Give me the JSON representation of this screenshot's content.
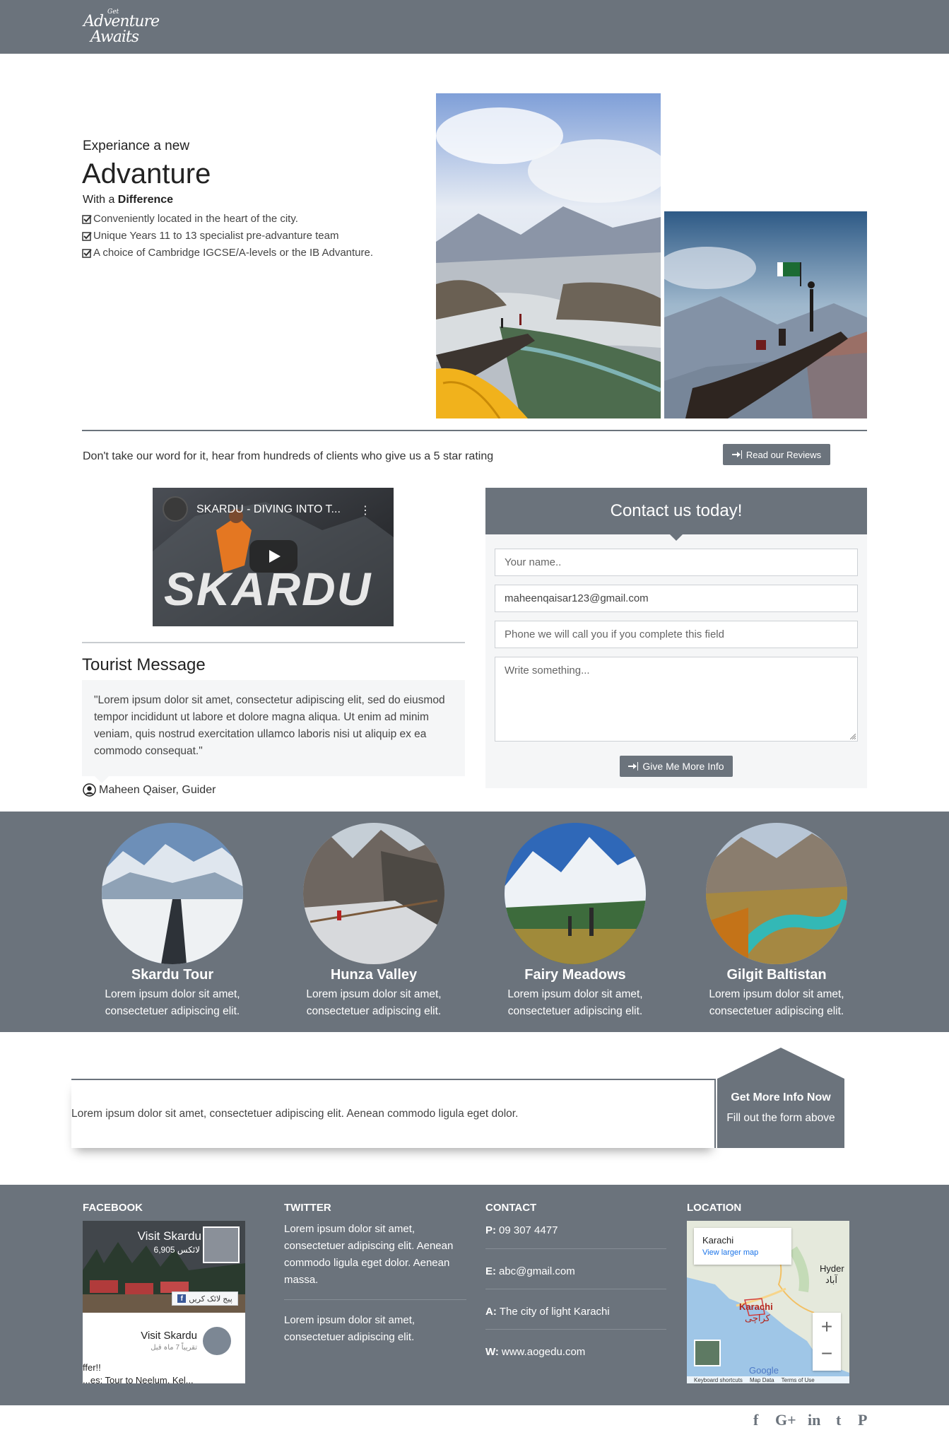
{
  "header": {
    "logo_line1": "Get",
    "logo_line2": "Adventure",
    "logo_line3": "Awaits"
  },
  "hero": {
    "subtitle": "Experiance a new",
    "title": "Advanture",
    "with_prefix": "With a",
    "with_bold": "Difference",
    "items": [
      "Conveniently located in the heart of the city.",
      "Unique Years 11 to 13 specialist pre-advanture team",
      "A choice of Cambridge IGCSE/A-levels or the IB Advanture."
    ]
  },
  "reviews": {
    "text": "Don't take our word for it, hear from hundreds of clients who give us a 5 star rating",
    "button_label": "Read our Reviews"
  },
  "video": {
    "title": "SKARDU - DIVING INTO T...",
    "overlay_word": "SKARDU"
  },
  "testimonial": {
    "title": "Tourist Message",
    "quote": "\"Lorem ipsum dolor sit amet, consectetur adipiscing elit, sed do eiusmod tempor incididunt ut labore et dolore magna aliqua. Ut enim ad minim veniam, quis nostrud exercitation ullamco laboris nisi ut aliquip ex ea commodo consequat.\"",
    "author": "Maheen Qaiser, Guider"
  },
  "contact_form": {
    "title": "Contact us today!",
    "name_placeholder": "Your name..",
    "email_value": "maheenqaisar123@gmail.com",
    "phone_placeholder": "Phone we will call you if you complete this field",
    "message_placeholder": "Write something...",
    "submit_label": "Give Me More Info"
  },
  "destinations": [
    {
      "name": "Skardu Tour",
      "desc_line1": "Lorem ipsum dolor sit amet,",
      "desc_line2": "consectetuer adipiscing elit."
    },
    {
      "name": "Hunza Valley",
      "desc_line1": "Lorem ipsum dolor sit amet,",
      "desc_line2": "consectetuer adipiscing elit."
    },
    {
      "name": "Fairy Meadows",
      "desc_line1": "Lorem ipsum dolor sit amet,",
      "desc_line2": "consectetuer adipiscing elit."
    },
    {
      "name": "Gilgit Baltistan",
      "desc_line1": "Lorem ipsum dolor sit amet,",
      "desc_line2": "consectetuer adipiscing elit."
    }
  ],
  "cta": {
    "text": "Lorem ipsum dolor sit amet, consectetuer adipiscing elit. Aenean commodo ligula eget dolor.",
    "heading": "Get More Info Now",
    "subheading": "Fill out the form above"
  },
  "footer": {
    "facebook": {
      "title": "FACEBOOK",
      "page_name": "Visit Skardu",
      "likes": "6,905 لائکس",
      "like_button": "پیج لائک کریں",
      "post_name": "Visit Skardu",
      "post_time": "تقریباً 7 ماہ قبل",
      "post_text1": "ffer!!",
      "post_text2": "...es: Tour to Neelum, Kel..."
    },
    "twitter": {
      "title": "TWITTER",
      "text1": "Lorem ipsum dolor sit amet, consectetuer adipiscing elit. Aenean commodo ligula eget dolor. Aenean massa.",
      "text2": "Lorem ipsum dolor sit amet, consectetuer adipiscing elit."
    },
    "contact": {
      "title": "CONTACT",
      "phone_label": "P:",
      "phone": "09 307 4477",
      "email_label": "E:",
      "email": "abc@gmail.com",
      "address_label": "A:",
      "address": "The city of light Karachi",
      "web_label": "W:",
      "web": "www.aogedu.com"
    },
    "location": {
      "title": "LOCATION",
      "place": "Karachi",
      "view_larger": "View larger map",
      "city_label": "Karachi",
      "city_urdu": "کراچی",
      "hyderabad": "Hyder",
      "hyderabad2": "آباد",
      "google": "Google",
      "shortcuts": "Keyboard shortcuts",
      "map_data": "Map Data",
      "terms": "Terms of Use"
    }
  },
  "social": {
    "facebook": "f",
    "google_plus": "G+",
    "linkedin": "in",
    "tumblr": "t",
    "pinterest": "P"
  },
  "colors": {
    "primary": "#6b737c",
    "light_panel": "#f5f6f7",
    "white": "#ffffff"
  }
}
